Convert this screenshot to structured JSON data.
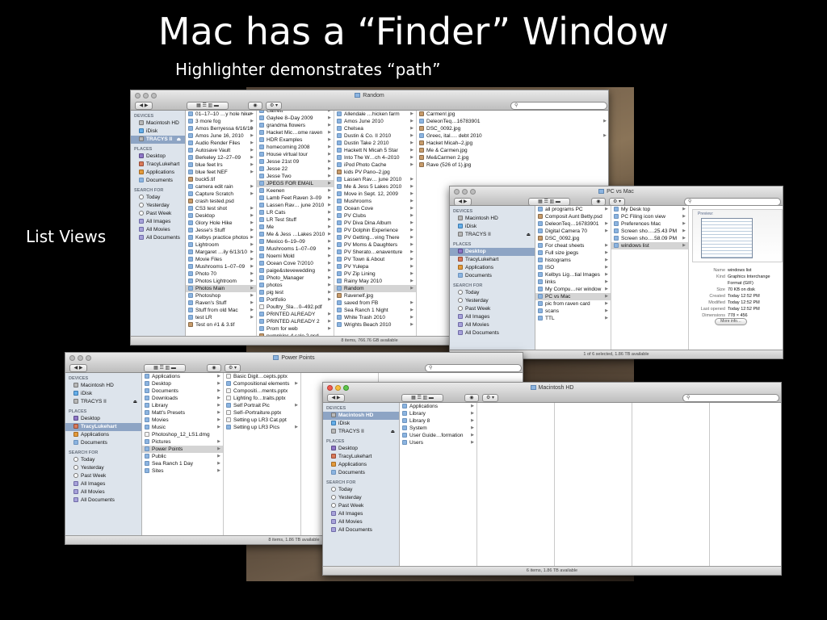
{
  "slide": {
    "title": "Mac has a “Finder” Window",
    "subtitle": "Highlighter demonstrates “path”",
    "side_label": "List Views"
  },
  "windows": {
    "random": {
      "title": "Random",
      "sidebar": {
        "devices_header": "DEVICES",
        "devices": [
          "Macintosh HD",
          "iDisk",
          "TRACYS II"
        ],
        "places_header": "PLACES",
        "places": [
          "Desktop",
          "TracyLukehart",
          "Applications",
          "Documents"
        ],
        "search_header": "SEARCH FOR",
        "search": [
          "Today",
          "Yesterday",
          "Past Week",
          "All Images",
          "All Movies",
          "All Documents"
        ]
      },
      "col1": [
        "01–17–10 …y hole hike",
        "3 more fog",
        "Amos Berryessa 6/16/10",
        "Amos June 16, 2010",
        "Audio Render Files",
        "Autosave Vault",
        "Berkeley 12–27–09",
        "blue feet lrs",
        "blue feet NEF",
        "buck5.tif",
        "camera edit rain",
        "Capture Scratch",
        "crash tested.psd",
        "CS3 test shot",
        "Desktop",
        "Glory Hole Hike",
        "Jesse's Stuff",
        "Kelbys practice photos",
        "Lightroom",
        "Margaret …ily 6/13/10",
        "Movie Files",
        "Mushrooms 1–07–09",
        "Photo 70",
        "Photos Lightroom",
        "Photos Main",
        "Photoshop",
        "Raven's Stuff",
        "Stuff from old Mac",
        "test LR",
        "Test on #1 & 3.tif"
      ],
      "col2": [
        "Garrett",
        "Gaylee 8–Day 2009",
        "grandma flowers",
        "Hacket Mic…ome raven",
        "HDR Examples",
        "homecoming 2008",
        "House virtual tour",
        "Jesse 21st 09",
        "Jesse 22",
        "Jesse Two",
        "JPEGS FOR EMAIL",
        "Keenen",
        "Lamb Feet Raven 3–09",
        "Lassen Rav… june 2010",
        "LR Cats",
        "LR Test Stuff",
        "Me",
        "Me & Jess …Lakes 2010",
        "Mexico 6–19–09",
        "Mushrooms 1–07–09",
        "Noemi Mold",
        "Ocean Cove 7/2010",
        "paige&stevewedding",
        "Photo_Manager",
        "photos",
        "pig test",
        "Portfolio",
        "Poultry_Sla…0–492.pdf",
        "PRINTED ALREADY",
        "PRINTED ALREADY 2",
        "Prom for web",
        "pumpkins 4 sale 2.psd"
      ],
      "col3": [
        "Allendale …hicken farm",
        "Amos June 2010",
        "Chelsea",
        "Dustin & Co. II 2010",
        "Dustin Take 2 2010",
        "Hackett N Micah 5 Star",
        "Into The W…ch 4–2010",
        "iPod Photo Cache",
        "kids PV Pano–2.jpg",
        "Lassen Rav… june 2010",
        "Me & Jess 5 Lakes 2010",
        "Move in Sept. 12, 2009",
        "Mushrooms",
        "Ocean Cove",
        "PV Clubs",
        "PV Diva Dina Album",
        "PV Dolphin Experience",
        "PV Getting…ving There",
        "PV Moms & Daughters",
        "PV Sherato…enaventure",
        "PV Town & About",
        "PV Yulepa",
        "PV Zip Lining",
        "Rainy May 2010",
        "Random",
        "Ravenelf.jpg",
        "saved from FB",
        "Sea Ranch 1 Night",
        "White Trash 2010",
        "Wrights Beach 2010"
      ],
      "col4": [
        "Carmen!.jpg",
        "DeleonTeq…16783901",
        "DSC_0092.jpg",
        "Greec, ital…. debt 2010",
        "Hacket Micah–2.jpg",
        "Me & Carmen.jpg",
        "Me&Carmen 2.jpg",
        "Rave (526 of 1).jpg"
      ],
      "status": "8 items, 766.76 GB available"
    },
    "pcvsmac": {
      "title": "PC vs Mac",
      "sidebar": {
        "devices_header": "DEVICES",
        "devices": [
          "Macintosh HD",
          "iDisk",
          "TRACYS II"
        ],
        "places_header": "PLACES",
        "places": [
          "Desktop",
          "TracyLukehart",
          "Applications",
          "Documents"
        ],
        "search_header": "SEARCH FOR",
        "search": [
          "Today",
          "Yesterday",
          "Past Week",
          "All Images",
          "All Movies",
          "All Documents"
        ]
      },
      "col1": [
        "all programs PC",
        "Composit Aunt Betty.psd",
        "DeleonTeq…16783901",
        "Digital Camera 70",
        "DSC_0092.jpg",
        "For cheat sheets",
        "Full size jpegs",
        "histograms",
        "ISO",
        "Kelbys Lig…tial Images",
        "links",
        "My Compu…rer window",
        "PC vs Mac",
        "pic from raven card",
        "scans",
        "TTL"
      ],
      "col2": [
        "My Desk top",
        "PC Filing icon view",
        "Preferences Mac",
        "Screen sho….25.43 PM",
        "Screen sho….58.09 PM",
        "windows list"
      ],
      "preview_label": "Preview:",
      "info": [
        {
          "k": "Name",
          "v": "windows list"
        },
        {
          "k": "Kind",
          "v": "Graphics Interchange Format (GIF)"
        },
        {
          "k": "Size",
          "v": "70 KB on disk"
        },
        {
          "k": "Created",
          "v": "Today 12:52 PM"
        },
        {
          "k": "Modified",
          "v": "Today 12:52 PM"
        },
        {
          "k": "Last opened",
          "v": "Today 12:52 PM"
        },
        {
          "k": "Dimensions",
          "v": "778 × 456"
        }
      ],
      "more_info": "More info…",
      "status": "1 of 6 selected, 1.86 TB available"
    },
    "powerpoints": {
      "title": "Power Points",
      "sidebar": {
        "devices_header": "DEVICES",
        "devices": [
          "Macintosh HD",
          "iDisk",
          "TRACYS II"
        ],
        "places_header": "PLACES",
        "places": [
          "Desktop",
          "TracyLukehart",
          "Applications",
          "Documents"
        ],
        "search_header": "SEARCH FOR",
        "search": [
          "Today",
          "Yesterday",
          "Past Week",
          "All Images",
          "All Movies",
          "All Documents"
        ]
      },
      "col1": [
        "Applications",
        "Desktop",
        "Documents",
        "Downloads",
        "Library",
        "Matt's Presets",
        "Movies",
        "Music",
        "Photoshop_12_LS1.dmg",
        "Pictures",
        "Power Points",
        "Public",
        "Sea Ranch 1 Day",
        "Sites"
      ],
      "col2": [
        "Basic Digit…cepts.pptx",
        "Compositional elements",
        "Compositi…ments.pptx",
        "Lighting fo…traits.pptx",
        "Self Portrait Pic",
        "Self–Portraiture.pptx",
        "Setting up LR3 Cat.ppt",
        "Setting up LR3 Pics"
      ],
      "status": "8 items, 1.86 TB available"
    },
    "machd": {
      "title": "Macintosh HD",
      "sidebar": {
        "devices_header": "DEVICES",
        "devices": [
          "Macintosh HD",
          "iDisk",
          "TRACYS II"
        ],
        "places_header": "PLACES",
        "places": [
          "Desktop",
          "TracyLukehart",
          "Applications",
          "Documents"
        ],
        "search_header": "SEARCH FOR",
        "search": [
          "Today",
          "Yesterday",
          "Past Week",
          "All Images",
          "All Movies",
          "All Documents"
        ]
      },
      "col1": [
        "Applications",
        "Library",
        "Library 8",
        "System",
        "User Guide…formation",
        "Users"
      ],
      "status": "6 items, 1.86 TB available"
    }
  }
}
